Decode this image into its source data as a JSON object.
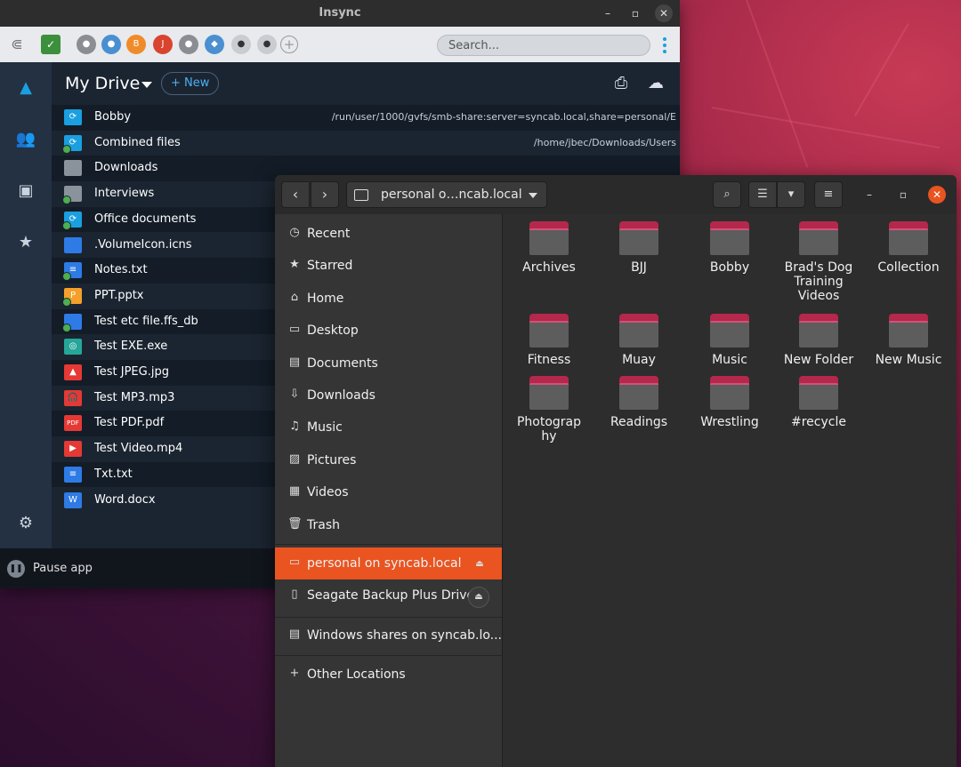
{
  "insync": {
    "title": "Insync",
    "search_placeholder": "Search...",
    "drive_title": "My Drive",
    "new_button": "New",
    "pause_label": "Pause app",
    "files": [
      {
        "name": "Bobby",
        "path": "/run/user/1000/gvfs/smb-share:server=syncab.local,share=personal/E",
        "icon": "sync-folder-icon",
        "color": "#1a9fe0"
      },
      {
        "name": "Combined files",
        "path": "/home/jbec/Downloads/Users",
        "icon": "sync-folder-icon",
        "color": "#1a9fe0"
      },
      {
        "name": "Downloads",
        "path": "",
        "icon": "folder-icon",
        "color": "#8a929b"
      },
      {
        "name": "Interviews",
        "path": "",
        "icon": "folder-icon",
        "color": "#8a929b"
      },
      {
        "name": "Office documents",
        "path": "",
        "icon": "sync-folder-icon",
        "color": "#1a9fe0"
      },
      {
        "name": ".VolumeIcon.icns",
        "path": "",
        "icon": "file-icon",
        "color": "#2e7be6"
      },
      {
        "name": "Notes.txt",
        "path": "",
        "icon": "text-file-icon",
        "color": "#2e7be6"
      },
      {
        "name": "PPT.pptx",
        "path": "",
        "icon": "slides-file-icon",
        "color": "#f4a02a"
      },
      {
        "name": "Test etc file.ffs_db",
        "path": "",
        "icon": "file-icon",
        "color": "#2e7be6"
      },
      {
        "name": "Test EXE.exe",
        "path": "",
        "icon": "exe-file-icon",
        "color": "#26a69a"
      },
      {
        "name": "Test JPEG.jpg",
        "path": "",
        "icon": "image-file-icon",
        "color": "#e53935"
      },
      {
        "name": "Test MP3.mp3",
        "path": "",
        "icon": "audio-file-icon",
        "color": "#e53935"
      },
      {
        "name": "Test PDF.pdf",
        "path": "",
        "icon": "pdf-file-icon",
        "color": "#e53935"
      },
      {
        "name": "Test Video.mp4",
        "path": "",
        "icon": "video-file-icon",
        "color": "#e53935"
      },
      {
        "name": "Txt.txt",
        "path": "",
        "icon": "text-file-icon",
        "color": "#2e7be6"
      },
      {
        "name": "Word.docx",
        "path": "",
        "icon": "word-file-icon",
        "color": "#2e7be6"
      }
    ]
  },
  "files_app": {
    "location": "personal o…ncab.local",
    "sidebar": [
      {
        "label": "Recent",
        "icon": "clock-icon"
      },
      {
        "label": "Starred",
        "icon": "star-icon"
      },
      {
        "label": "Home",
        "icon": "home-icon"
      },
      {
        "label": "Desktop",
        "icon": "desktop-icon"
      },
      {
        "label": "Documents",
        "icon": "documents-icon"
      },
      {
        "label": "Downloads",
        "icon": "download-icon"
      },
      {
        "label": "Music",
        "icon": "music-icon"
      },
      {
        "label": "Pictures",
        "icon": "pictures-icon"
      },
      {
        "label": "Videos",
        "icon": "videos-icon"
      },
      {
        "label": "Trash",
        "icon": "trash-icon"
      }
    ],
    "devices": [
      {
        "label": "personal on syncab.local",
        "icon": "network-folder-icon",
        "active": true
      },
      {
        "label": "Seagate Backup Plus Drive",
        "icon": "usb-drive-icon",
        "active": false
      }
    ],
    "network": {
      "label": "Windows shares on syncab.lo...",
      "icon": "server-icon"
    },
    "other": {
      "label": "Other Locations",
      "icon": "plus-icon"
    },
    "folders": [
      "Archives",
      "BJJ",
      "Bobby",
      "Brad's Dog\nTraining\nVideos",
      "Collection",
      "Fitness",
      "Muay",
      "Music",
      "New Folder",
      "New Music",
      "Photograp\nhy",
      "Readings",
      "Wrestling",
      "#recycle"
    ],
    "accent": "#e95420"
  }
}
